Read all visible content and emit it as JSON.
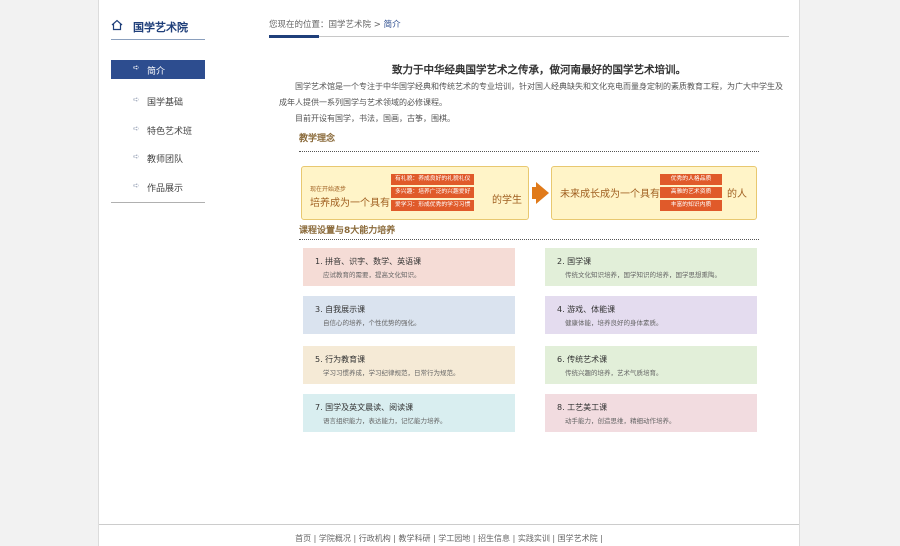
{
  "sidebar": {
    "title": "国学艺术院",
    "items": [
      {
        "label": "简介"
      },
      {
        "label": "国学基础"
      },
      {
        "label": "特色艺术班"
      },
      {
        "label": "教师团队"
      },
      {
        "label": "作品展示"
      }
    ]
  },
  "breadcrumb": {
    "prefix": "您现在的位置：",
    "parent": "国学艺术院",
    "sep": " > ",
    "current": "简介"
  },
  "intro": {
    "headline": "致力于中华经典国学艺术之传承，做河南最好的国学艺术培训。",
    "para1": "国学艺术馆是一个专注于中华国学经典和传统艺术的专业培训，针对国人经典缺失和文化充电而量身定制的素质教育工程，为广大中学生及成年人提供一系列国学与艺术领域的必修课程。",
    "para2": "目前开设有国学，书法，国画，古筝，围棋。"
  },
  "concept": {
    "title": "教学理念",
    "left_small": "现在开始逐步",
    "left_big": "培养成为一个具有",
    "left_tags": [
      "有礼貌：养成良好的礼貌礼仪",
      "多兴趣：培养广泛的兴趣爱好",
      "爱学习：形成优秀的学习习惯"
    ],
    "left_end": "的学生",
    "right_big": "未来成长成为一个具有",
    "right_tags": [
      "优秀的人格品质",
      "高雅的艺术资质",
      "丰富的知识内质"
    ],
    "right_end": "的人"
  },
  "courses": {
    "title": "课程设置与8大能力培养",
    "items": [
      {
        "title": "1. 拼音、识字、数学、英语课",
        "desc": "应试教育的需要，提高文化知识。",
        "color": "#f5dcd6"
      },
      {
        "title": "2. 国学课",
        "desc": "传统文化知识培养，国学知识的培养，国学思想熏陶。",
        "color": "#e2efd9"
      },
      {
        "title": "3. 自我展示课",
        "desc": "自信心的培养，个性优势的强化。",
        "color": "#dae3ef"
      },
      {
        "title": "4. 游戏、体能课",
        "desc": "健康体能，培养良好的身体素质。",
        "color": "#e4dcef"
      },
      {
        "title": "5. 行为教育课",
        "desc": "学习习惯养成，学习纪律规范，日常行为规范。",
        "color": "#f5ead6"
      },
      {
        "title": "6. 传统艺术课",
        "desc": "传统兴趣的培养，艺术气质培育。",
        "color": "#e2efd9"
      },
      {
        "title": "7. 国学及英文晨读、阅读课",
        "desc": "语言组织能力，表达能力，记忆能力培养。",
        "color": "#d9eef0"
      },
      {
        "title": "8. 工艺美工课",
        "desc": "动手能力，创造思维，精细动作培养。",
        "color": "#f2dce0"
      }
    ]
  },
  "footer": {
    "links": [
      "首页",
      "学院概况",
      "行政机构",
      "教学科研",
      "学工园地",
      "招生信息",
      "实践实训",
      "国学艺术院"
    ]
  }
}
